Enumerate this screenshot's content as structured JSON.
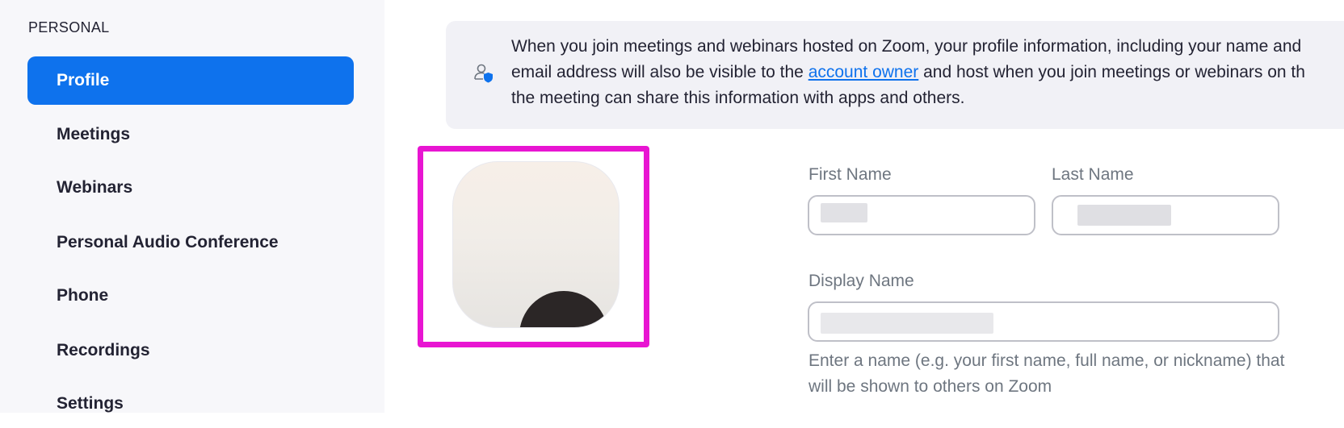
{
  "sidebar": {
    "section_label": "PERSONAL",
    "items": [
      {
        "label": "Profile",
        "active": true
      },
      {
        "label": "Meetings"
      },
      {
        "label": "Webinars"
      },
      {
        "label": "Personal Audio Conference"
      },
      {
        "label": "Phone"
      },
      {
        "label": "Recordings"
      },
      {
        "label": "Settings"
      }
    ]
  },
  "banner": {
    "icon": "user-shield-icon",
    "line1": "When you join meetings and webinars hosted on Zoom, your profile information, including your name and",
    "line2_before": "email address will also be visible to the ",
    "line2_link": "account owner",
    "line2_after": " and host when you join meetings or webinars on th",
    "line3": "the meeting can share this information with apps and others."
  },
  "profile": {
    "avatar": "profile-photo",
    "first_name_label": "First Name",
    "first_name_value": "",
    "last_name_label": "Last Name",
    "last_name_value": "",
    "display_name_label": "Display Name",
    "display_name_value": "",
    "display_name_help": "Enter a name (e.g. your first name, full name, or nickname) that will be shown to others on Zoom"
  },
  "colors": {
    "accent": "#0e72ed",
    "highlight": "#e815d2",
    "sidebar_bg": "#f7f7fa",
    "banner_bg": "#f1f1f6"
  }
}
